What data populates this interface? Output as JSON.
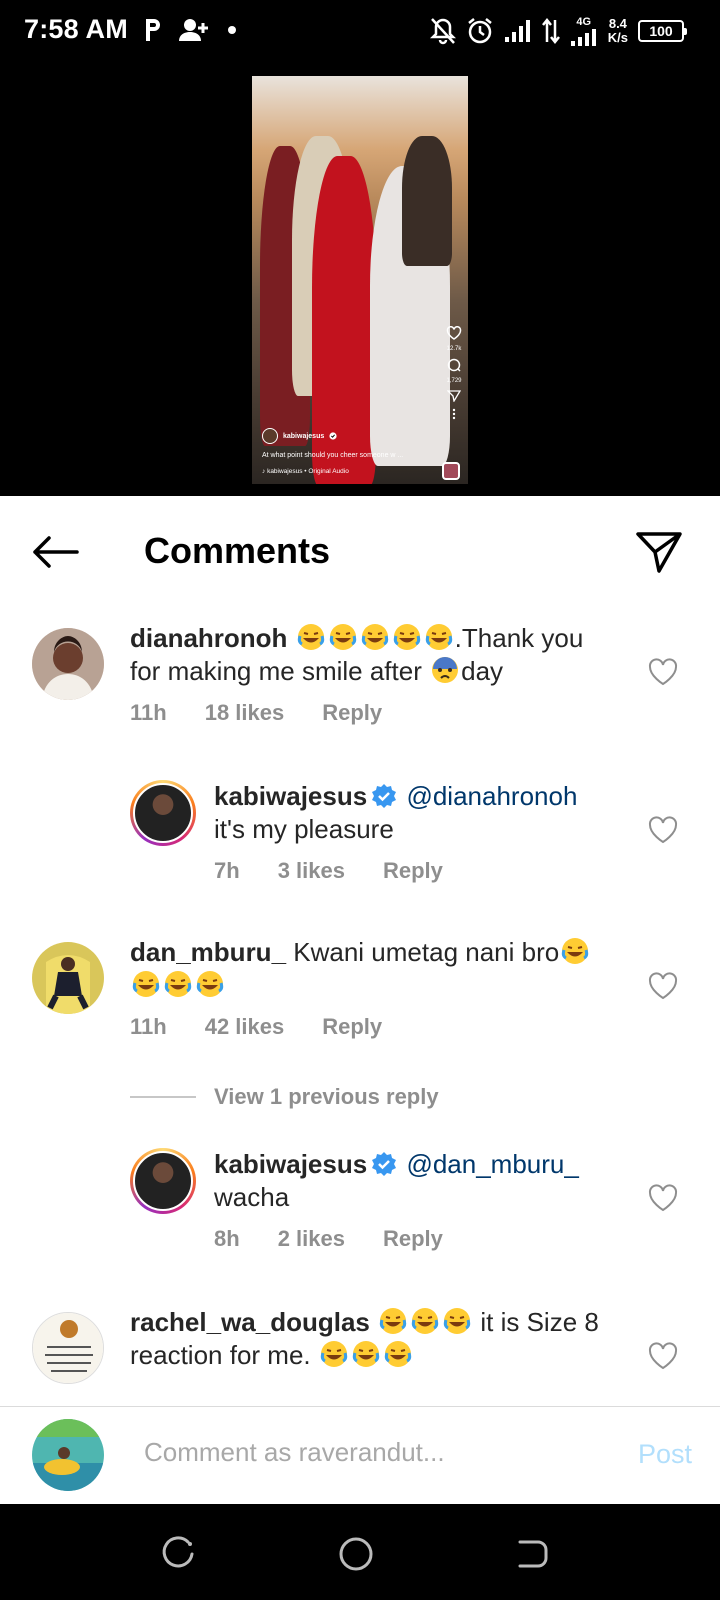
{
  "status_bar": {
    "time": "7:58 AM",
    "left_icons": [
      "parking-p-icon",
      "add-person-icon",
      "dot-icon"
    ],
    "network_speed_value": "8.4",
    "network_speed_unit": "K/s",
    "network_type": "4G",
    "battery": "100"
  },
  "video": {
    "likes": "12.7k",
    "comments": "1,729",
    "owner": "kabiwajesus",
    "caption": "At what point should you cheer someone w ...",
    "audio": "kabiwajesus • Original Audio"
  },
  "header": {
    "title": "Comments"
  },
  "comments": [
    {
      "username": "dianahronoh",
      "text_parts": [
        ".Thank you",
        "for making me smile after",
        "day"
      ],
      "time": "11h",
      "likes": "18 likes",
      "reply": "Reply"
    },
    {
      "username": "kabiwajesus",
      "mention": "@dianahronoh",
      "text": "it's my pleasure",
      "time": "7h",
      "likes": "3 likes",
      "reply": "Reply"
    },
    {
      "username": "dan_mburu_",
      "text": "Kwani umetag nani bro",
      "time": "11h",
      "likes": "42 likes",
      "reply": "Reply"
    },
    {
      "username": "kabiwajesus",
      "mention": "@dan_mburu_",
      "text": "wacha",
      "time": "8h",
      "likes": "2 likes",
      "reply": "Reply"
    },
    {
      "username": "rachel_wa_douglas",
      "text_parts": [
        "it is Size 8",
        "reaction for me."
      ]
    }
  ],
  "view_previous": "View 1 previous reply",
  "composer": {
    "placeholder": "Comment as raverandut...",
    "post_label": "Post"
  },
  "colors": {
    "accent_blue": "#3897f0",
    "post_disabled": "#b2dffc",
    "mention": "#00376b",
    "meta_gray": "#8e8e8e"
  }
}
